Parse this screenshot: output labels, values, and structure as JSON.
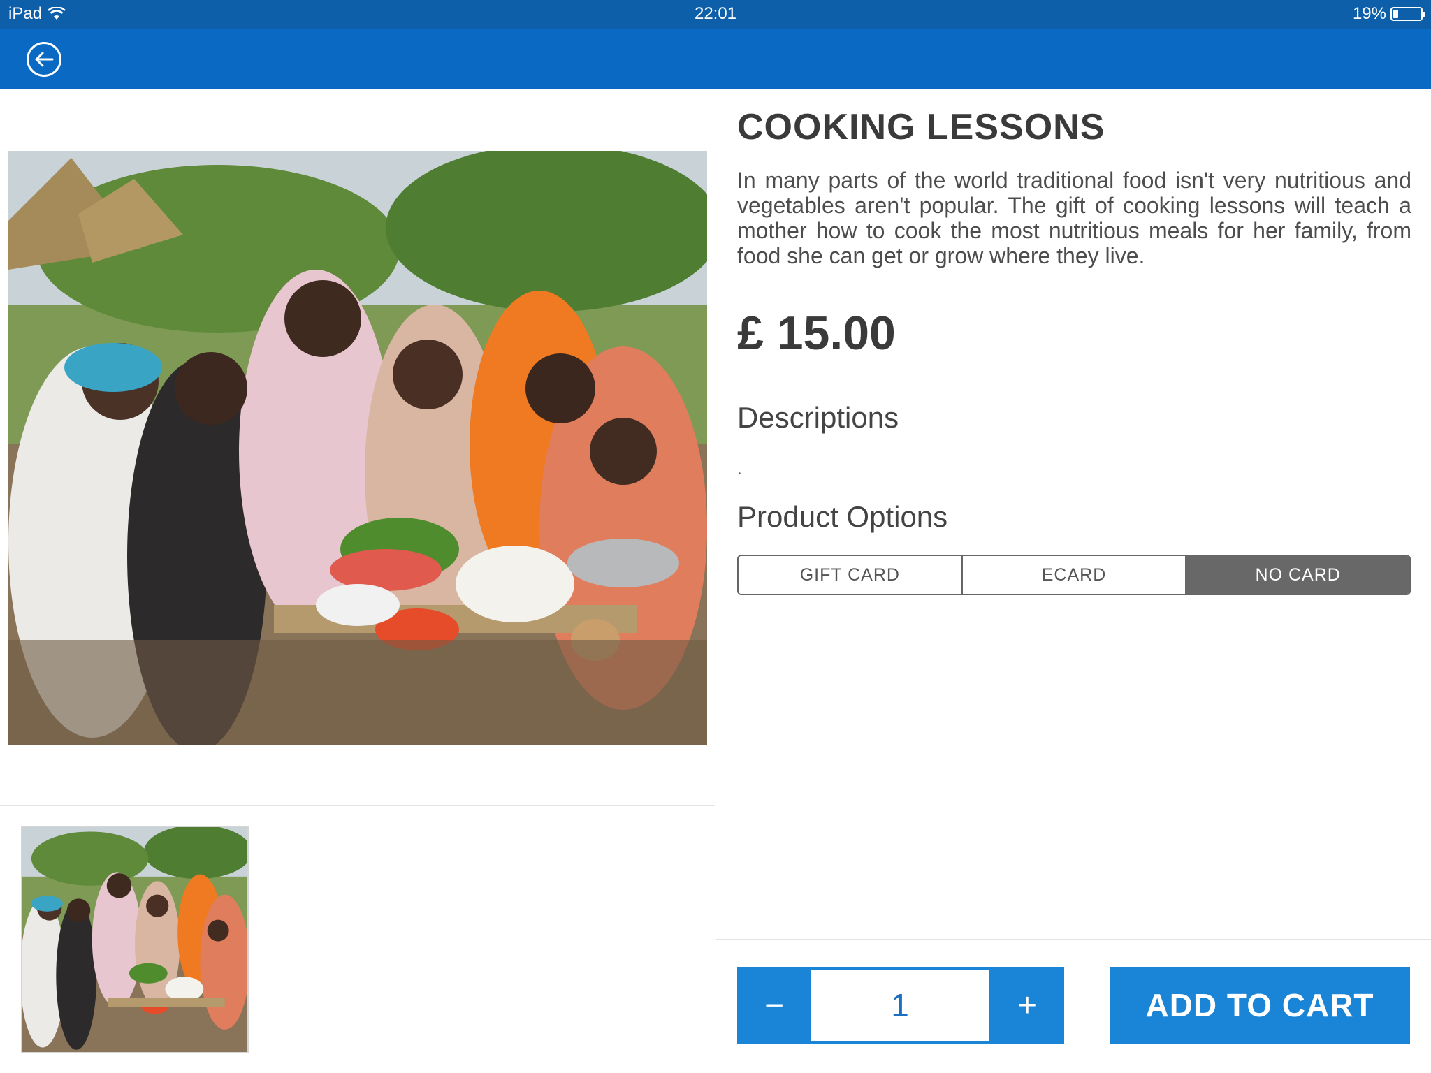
{
  "status_bar": {
    "device": "iPad",
    "time": "22:01",
    "battery": "19%",
    "battery_level": 0.19
  },
  "product": {
    "title": "COOKING LESSONS",
    "summary": "In many parts of the world traditional food isn't very nutritious and vegetables aren't popular. The gift of cooking lessons will teach a mother how to cook the most nutritious meals for her family, from food she can get or grow where they live.",
    "price": "£ 15.00",
    "descriptions_heading": "Descriptions",
    "descriptions_body": ".",
    "options_heading": "Product Options",
    "options": [
      {
        "label": "GIFT CARD",
        "selected": false
      },
      {
        "label": "ECARD",
        "selected": false
      },
      {
        "label": "NO CARD",
        "selected": true
      }
    ]
  },
  "cart": {
    "minus_label": "−",
    "quantity": "1",
    "plus_label": "+",
    "add_label": "ADD TO CART"
  },
  "colors": {
    "status_bar": "#0c5fa8",
    "nav_bar": "#0a6ac3",
    "accent_button": "#1a84d6",
    "selected_option": "#686868"
  }
}
